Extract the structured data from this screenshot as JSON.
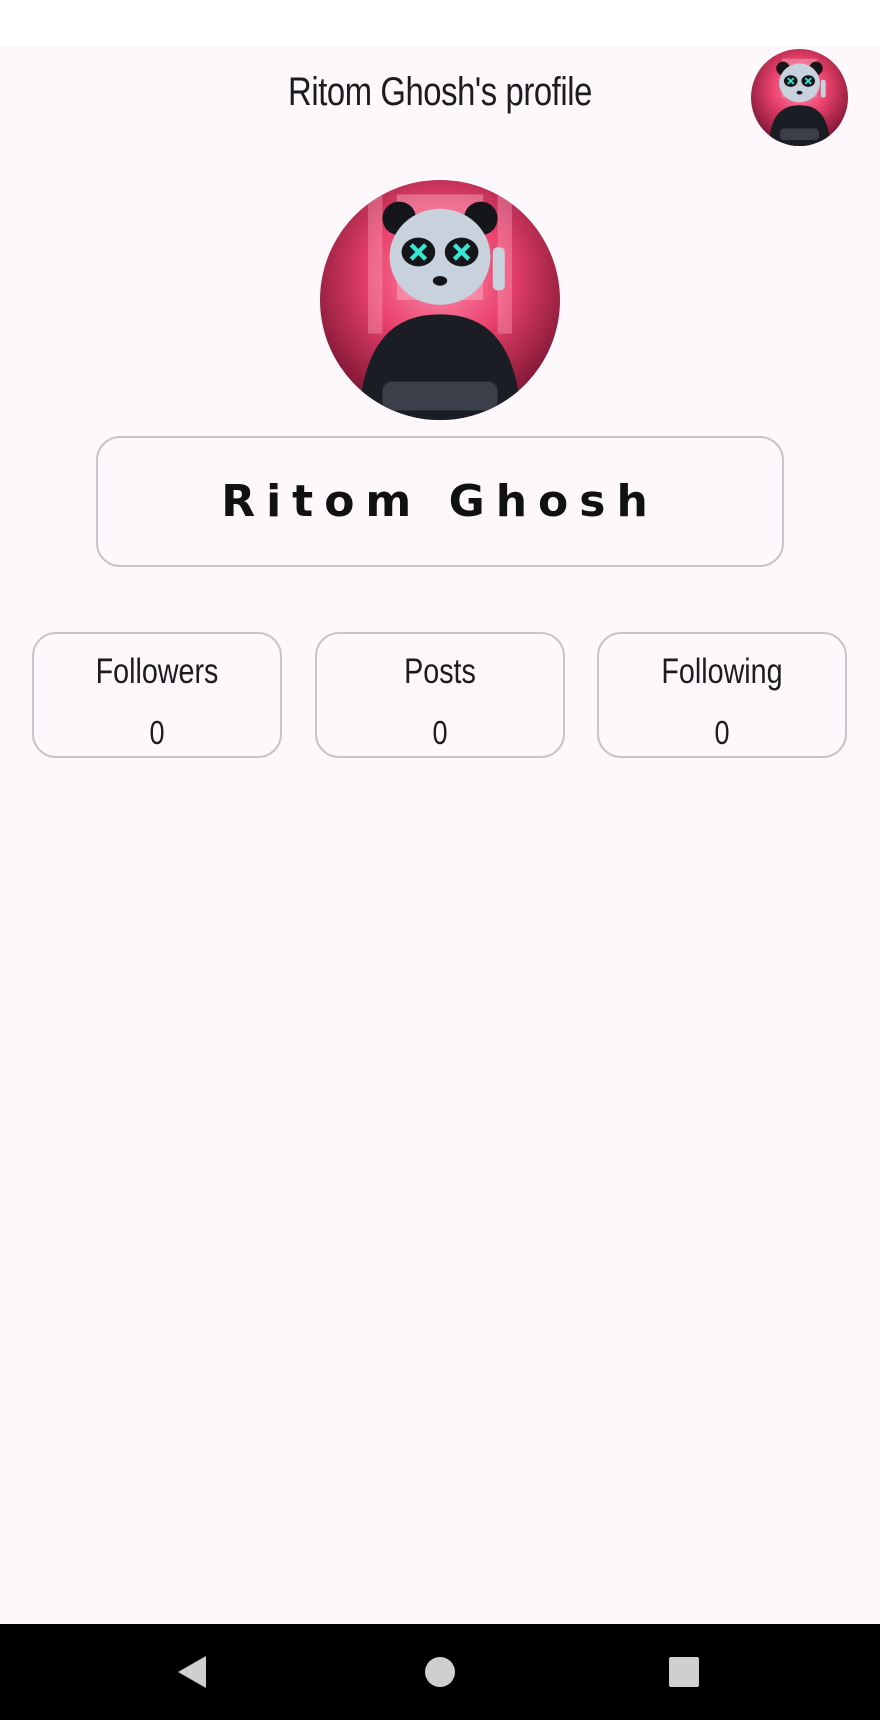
{
  "header": {
    "title": "Ritom Ghosh's profile",
    "avatar_icon": "panda-mask-avatar"
  },
  "profile": {
    "avatar_icon": "panda-mask-avatar",
    "name": "Ritom Ghosh"
  },
  "stats": {
    "followers": {
      "label": "Followers",
      "value": "0"
    },
    "posts": {
      "label": "Posts",
      "value": "0"
    },
    "following": {
      "label": "Following",
      "value": "0"
    }
  },
  "navigation": {
    "back_icon": "back-triangle-icon",
    "home_icon": "home-circle-icon",
    "recents_icon": "recents-square-icon"
  },
  "colors": {
    "background": "#fdf8fb",
    "card_border": "#c9c4ca",
    "text": "#1c1b1f",
    "nav_bar": "#000000",
    "avatar_accent": "#e8406b"
  }
}
